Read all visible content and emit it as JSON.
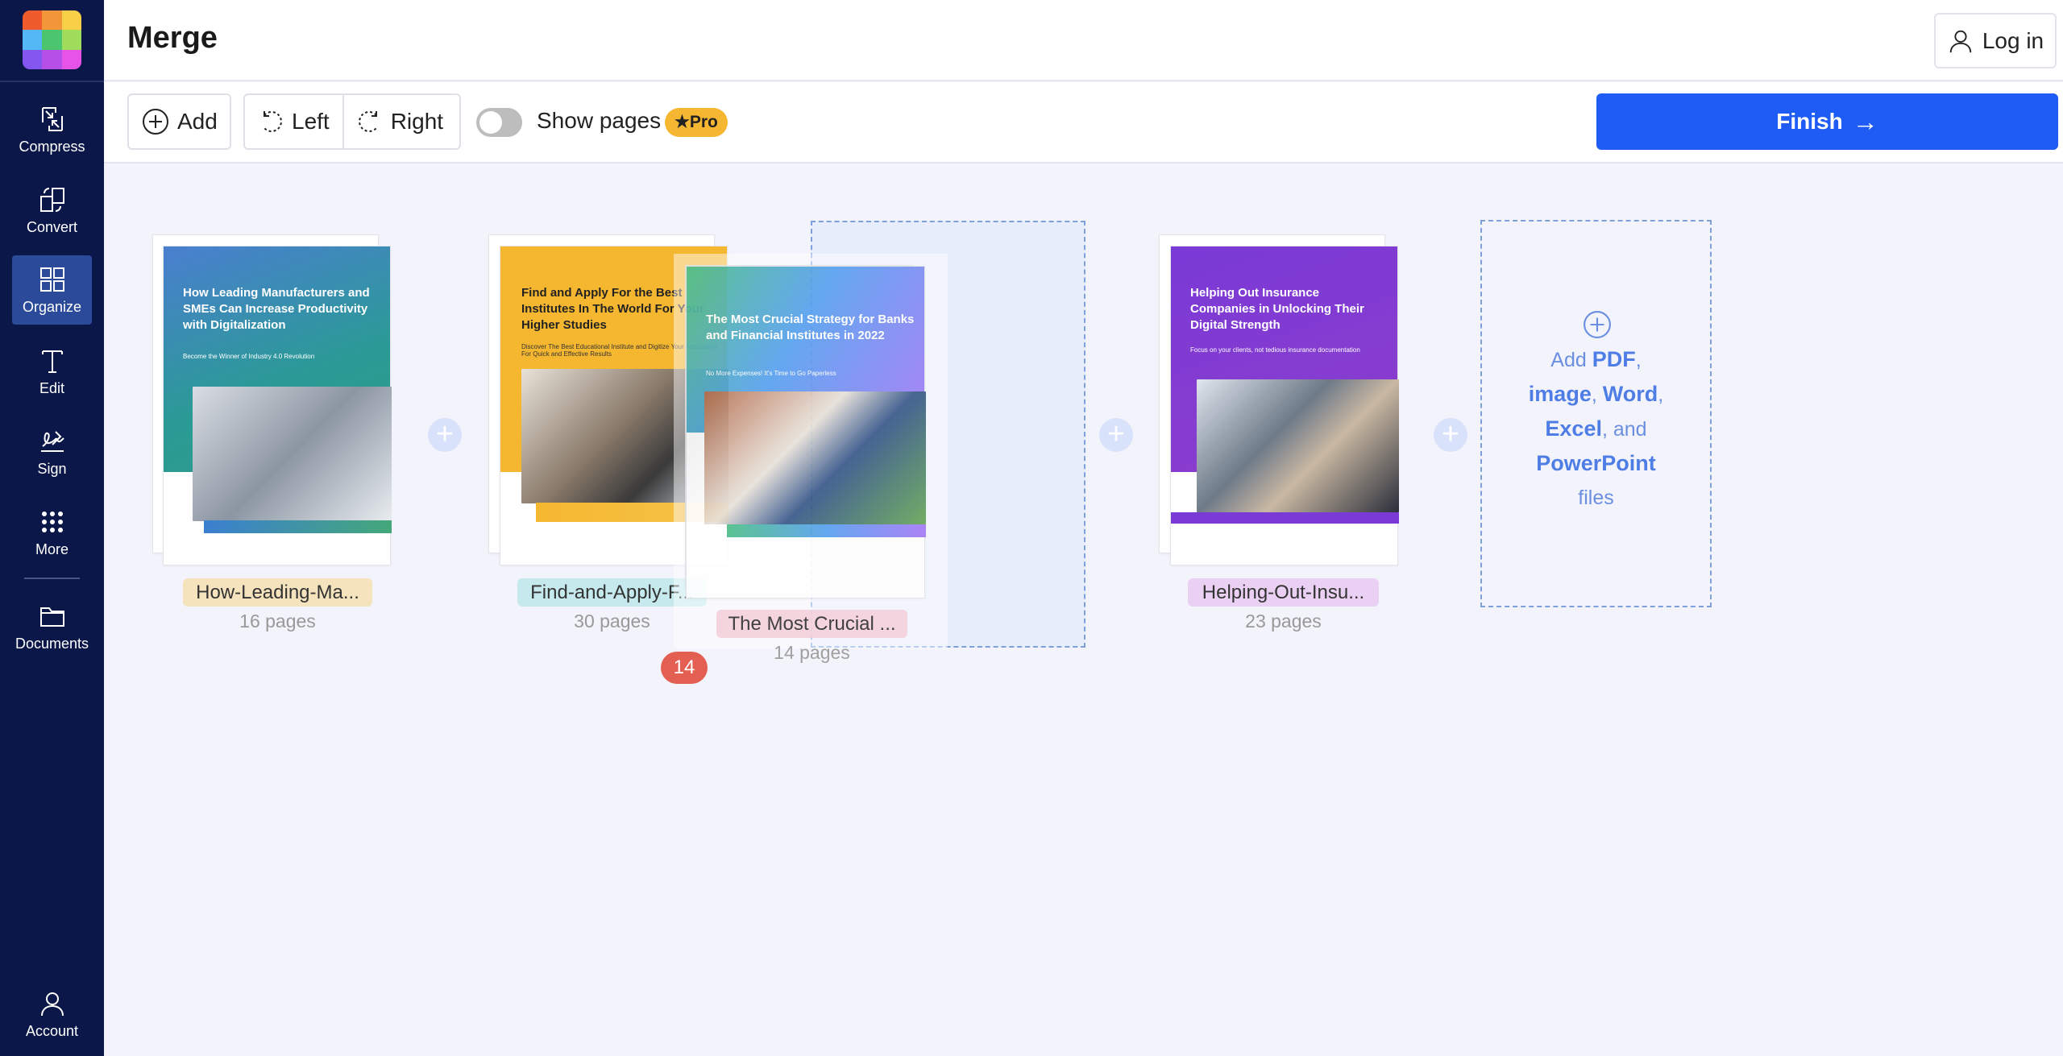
{
  "app": {
    "title": "Merge",
    "login": "Log in"
  },
  "sidebar": {
    "items": [
      {
        "label": "Compress"
      },
      {
        "label": "Convert"
      },
      {
        "label": "Organize"
      },
      {
        "label": "Edit"
      },
      {
        "label": "Sign"
      },
      {
        "label": "More"
      },
      {
        "label": "Documents"
      },
      {
        "label": "Account"
      }
    ]
  },
  "toolbar": {
    "add": "Add",
    "left": "Left",
    "right": "Right",
    "show_pages": "Show pages",
    "pro": "Pro",
    "finish": "Finish"
  },
  "files": [
    {
      "label": "How-Leading-Ma...",
      "pages": "16 pages",
      "cover_title": "How Leading Manufacturers and SMEs Can Increase Productivity with Digitalization",
      "cover_sub": "Become the Winner of Industry 4.0 Revolution"
    },
    {
      "label": "Find-and-Apply-F...",
      "pages": "30 pages",
      "cover_title": "Find and Apply For the Best Institutes In The World For Your Higher Studies",
      "cover_sub": "Discover The Best Educational Institute and Digitize Your Application For Quick and Effective Results"
    },
    {
      "label": "The Most Crucial ...",
      "pages": "14 pages",
      "cover_title": "The Most Crucial Strategy for Banks and Financial Institutes in 2022",
      "cover_sub": "No More Expenses! It's Time to Go Paperless"
    },
    {
      "label": "Helping-Out-Insu...",
      "pages": "23 pages",
      "cover_title": "Helping Out Insurance Companies in Unlocking Their Digital Strength",
      "cover_sub": "Focus on your clients, not tedious insurance documentation"
    }
  ],
  "drag_badge": "14",
  "add_card": {
    "t1": "Add ",
    "pdf": "PDF",
    "c1": ",",
    "image": "image",
    "c2": ", ",
    "word": "Word",
    "c3": ",",
    "excel": "Excel",
    "and": ", and",
    "ppt": "PowerPoint",
    "files": "files"
  }
}
